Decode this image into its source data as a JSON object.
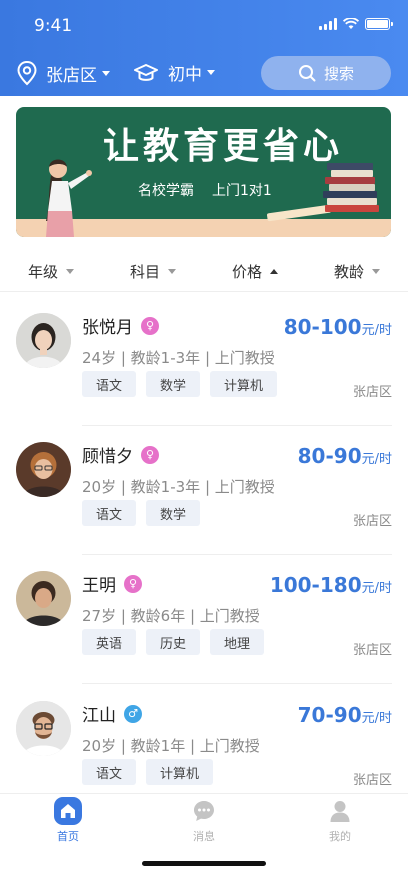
{
  "status": {
    "time": "9:41"
  },
  "header": {
    "location": "张店区",
    "grade": "初中",
    "search_label": "搜索"
  },
  "banner": {
    "title": "让教育更省心",
    "sub_left": "名校学霸",
    "sub_right": "上门1对1"
  },
  "filters": [
    {
      "label": "年级",
      "sort": "down"
    },
    {
      "label": "科目",
      "sort": "down"
    },
    {
      "label": "价格",
      "sort": "up"
    },
    {
      "label": "教龄",
      "sort": "down"
    }
  ],
  "teachers": [
    {
      "name": "张悦月",
      "gender": "♀",
      "price": "80-100",
      "unit": "元/时",
      "meta": "24岁 | 教龄1-3年 | 上门教授",
      "tags": [
        "语文",
        "数学",
        "计算机"
      ],
      "district": "张店区"
    },
    {
      "name": "顾惜夕",
      "gender": "♀",
      "price": "80-90",
      "unit": "元/时",
      "meta": "20岁 | 教龄1-3年 | 上门教授",
      "tags": [
        "语文",
        "数学"
      ],
      "district": "张店区"
    },
    {
      "name": "王明",
      "gender": "♀",
      "price": "100-180",
      "unit": "元/时",
      "meta": "27岁 | 教龄6年 | 上门教授",
      "tags": [
        "英语",
        "历史",
        "地理"
      ],
      "district": "张店区"
    },
    {
      "name": "江山",
      "gender": "♂",
      "price": "70-90",
      "unit": "元/时",
      "meta": "20岁 | 教龄1年 | 上门教授",
      "tags": [
        "语文",
        "计算机"
      ],
      "district": "张店区"
    }
  ],
  "tabbar": [
    {
      "label": "首页",
      "icon": "home-icon",
      "active": true
    },
    {
      "label": "消息",
      "icon": "chat-icon",
      "active": false
    },
    {
      "label": "我的",
      "icon": "user-icon",
      "active": false
    }
  ],
  "colors": {
    "primary": "#3a78e0",
    "banner_bg": "#1f6a4f",
    "female": "#e671c9",
    "male": "#3fa5e6"
  }
}
